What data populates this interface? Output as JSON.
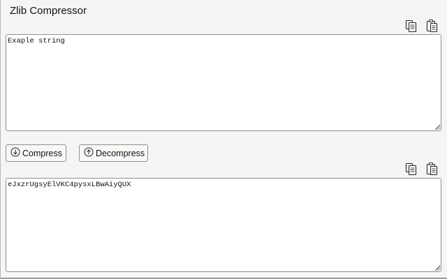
{
  "app": {
    "title": "Zlib Compressor"
  },
  "input_area": {
    "value": "Exaple string",
    "copy_icon": "copy-icon",
    "paste_icon": "paste-icon"
  },
  "actions": {
    "compress_label": "Compress",
    "compress_icon": "arrow-down-circle-icon",
    "decompress_label": "Decompress",
    "decompress_icon": "arrow-up-circle-icon"
  },
  "output_area": {
    "value": "eJxzrUgsyElVKC4pysxLBwAiyQUX",
    "copy_icon": "copy-icon",
    "paste_icon": "paste-icon"
  }
}
